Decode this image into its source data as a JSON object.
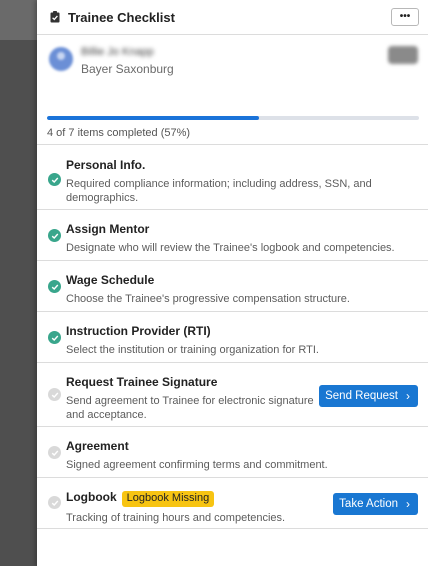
{
  "panel": {
    "title": "Trainee Checklist",
    "more_label": "•••"
  },
  "profile": {
    "name": "Billie Jo Knapp",
    "company": "Bayer Saxonburg",
    "progress_text": "4 of 7 items completed (57%)",
    "progress_fraction": 0.57
  },
  "checklist": [
    {
      "title": "Personal Info.",
      "description": "Required compliance information; including address, SSN, and demographics.",
      "status": "complete"
    },
    {
      "title": "Assign Mentor",
      "description": "Designate who will review the Trainee's logbook and competencies.",
      "status": "complete"
    },
    {
      "title": "Wage Schedule",
      "description": "Choose the Trainee's progressive compensation structure.",
      "status": "complete"
    },
    {
      "title": "Instruction Provider (RTI)",
      "description": "Select the institution or training organization for RTI.",
      "status": "complete"
    },
    {
      "title": "Request Trainee Signature",
      "description": "Send agreement to Trainee for electronic signature and acceptance.",
      "status": "pending",
      "action_label": "Send Request"
    },
    {
      "title": "Agreement",
      "description": "Signed agreement confirming terms and commitment.",
      "status": "pending"
    },
    {
      "title": "Logbook",
      "badge": "Logbook Missing",
      "description": "Tracking of training hours and competencies.",
      "status": "pending",
      "action_label": "Take Action"
    }
  ],
  "colors": {
    "accent": "#1977d2",
    "complete": "#39a68c",
    "pending": "#d9d9d9",
    "warning_badge": "#f7c412"
  }
}
